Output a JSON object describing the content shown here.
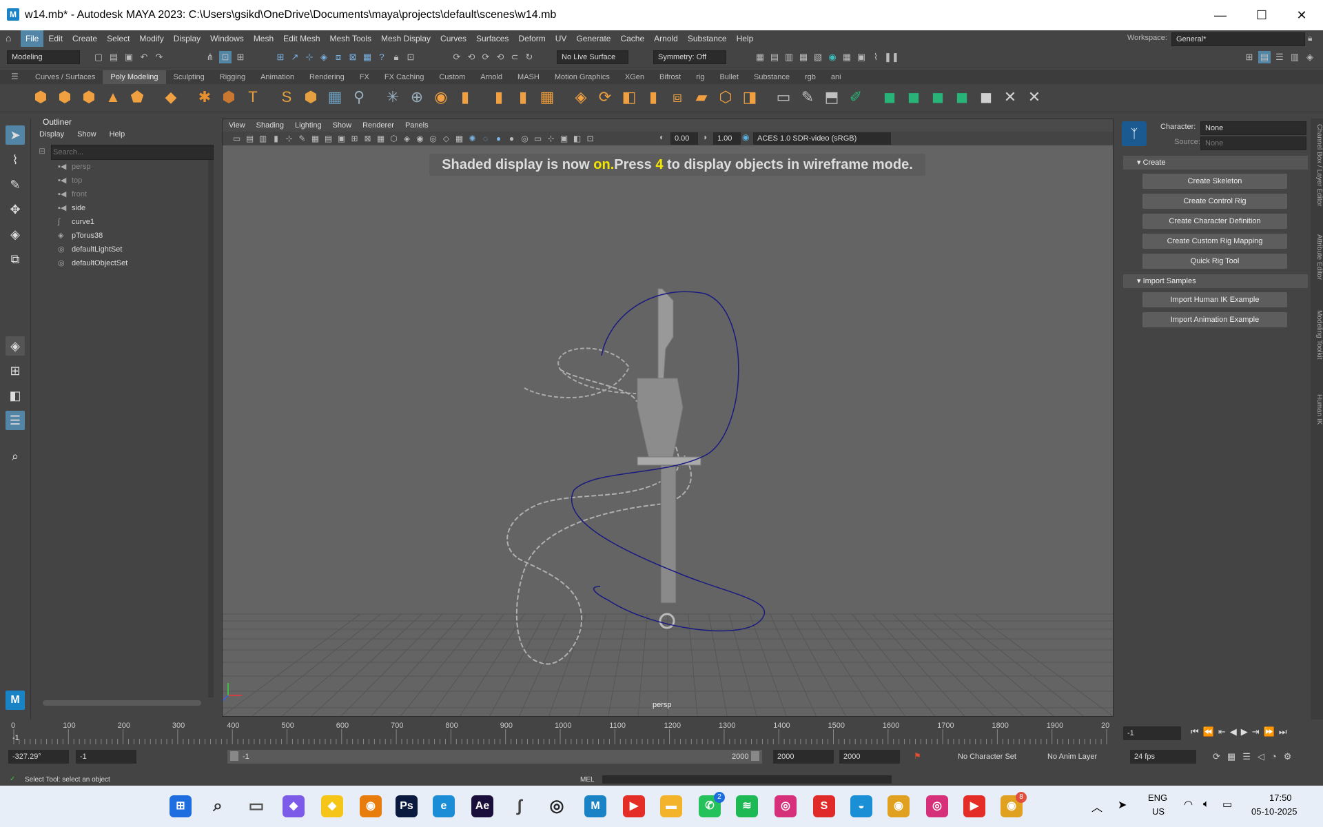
{
  "window": {
    "logo": "M",
    "title": "w14.mb* - Autodesk MAYA 2023: C:\\Users\\gsikd\\OneDrive\\Documents\\maya\\projects\\default\\scenes\\w14.mb",
    "minimize": "—",
    "maximize": "☐",
    "close": "✕"
  },
  "menubar": {
    "items": [
      "File",
      "Edit",
      "Create",
      "Select",
      "Modify",
      "Display",
      "Windows",
      "Mesh",
      "Edit Mesh",
      "Mesh Tools",
      "Mesh Display",
      "Curves",
      "Surfaces",
      "Deform",
      "UV",
      "Generate",
      "Cache",
      "Arnold",
      "Substance",
      "Help"
    ],
    "workspace_label": "Workspace:",
    "workspace_value": "General*"
  },
  "statusline": {
    "menuset": "Modeling",
    "live_surface": "No Live Surface",
    "symmetry": "Symmetry: Off"
  },
  "shelf": {
    "tabs": [
      "Curves / Surfaces",
      "Poly Modeling",
      "Sculpting",
      "Rigging",
      "Animation",
      "Rendering",
      "FX",
      "FX Caching",
      "Custom",
      "Arnold",
      "MASH",
      "Motion Graphics",
      "XGen",
      "Bifrost",
      "rig",
      "Bullet",
      "Substance",
      "rgb",
      "ani"
    ],
    "active_tab": "Poly Modeling",
    "colors": [
      "#f0a040",
      "#f0a040",
      "#f0a040",
      "#f0a040",
      "#f0a040",
      "#f0a040",
      "#e69030",
      "#c87830",
      "#e6a040",
      "#e6a040",
      "#e6a040",
      "#6fa0c0",
      "#9ab0c0",
      "#9ab0c0",
      "#9ab0c0",
      "#f0a040",
      "#f0a040",
      "#f0a040",
      "#f0a040",
      "#f0a040",
      "#f0a040",
      "#f0a040",
      "#f0a040",
      "#f0a040",
      "#f0a040",
      "#f0a040",
      "#f0a040",
      "#f0a040",
      "#c0c0c0",
      "#c0c0c0",
      "#c0c0c0",
      "#28b478",
      "#28b478",
      "#28b478",
      "#28b478",
      "#28b478",
      "#d0d0d0",
      "#d0d0d0",
      "#d0d0d0"
    ]
  },
  "outliner": {
    "title": "Outliner",
    "menu": [
      "Display",
      "Show",
      "Help"
    ],
    "search_placeholder": "Search...",
    "items": [
      {
        "label": "persp",
        "icon": "camera-icon",
        "dim": true
      },
      {
        "label": "top",
        "icon": "camera-icon",
        "dim": true
      },
      {
        "label": "front",
        "icon": "camera-icon",
        "dim": true
      },
      {
        "label": "side",
        "icon": "camera-icon",
        "dim": false
      },
      {
        "label": "curve1",
        "icon": "curve-icon",
        "dim": false
      },
      {
        "label": "pTorus38",
        "icon": "mesh-icon",
        "dim": false
      },
      {
        "label": "defaultLightSet",
        "icon": "set-icon",
        "dim": false
      },
      {
        "label": "defaultObjectSet",
        "icon": "set-icon",
        "dim": false
      }
    ]
  },
  "viewport": {
    "menu": [
      "View",
      "Shading",
      "Lighting",
      "Show",
      "Renderer",
      "Panels"
    ],
    "exposure": "0.00",
    "gamma": "1.00",
    "colorspace": "ACES 1.0 SDR-video (sRGB)",
    "message_part1": "Shaded display is now ",
    "message_on": "on.",
    "message_part2": "Press ",
    "message_key": "4",
    "message_part3": " to display objects in wireframe mode.",
    "camera_label": "persp"
  },
  "humanik": {
    "character_label": "Character:",
    "character_value": "None",
    "source_label": "Source:",
    "source_value": "None",
    "create_header": "Create",
    "create_buttons": [
      "Create Skeleton",
      "Create Control Rig",
      "Create Character Definition",
      "Create Custom Rig Mapping",
      "Quick Rig Tool"
    ],
    "samples_header": "Import Samples",
    "sample_buttons": [
      "Import Human IK Example",
      "Import Animation Example"
    ]
  },
  "sidetabs": [
    "Channel Box / Layer Editor",
    "Attribute Editor",
    "Modeling Toolkit",
    "Human IK"
  ],
  "timeline": {
    "ticks": [
      "0",
      "100",
      "200",
      "300",
      "400",
      "500",
      "600",
      "700",
      "800",
      "900",
      "1000",
      "1100",
      "1200",
      "1300",
      "1400",
      "1500",
      "1600",
      "1700",
      "1800",
      "1900",
      "20"
    ],
    "current_frame_marker": "-1",
    "current_frame_field": "-1"
  },
  "range": {
    "coord": "-327.29°",
    "start": "-1",
    "slider_start": "-1",
    "slider_end": "2000",
    "end1": "2000",
    "end2": "2000",
    "character_set": "No Character Set",
    "anim_layer": "No Anim Layer",
    "fps": "24 fps"
  },
  "helpline": {
    "text": "Select Tool: select an object",
    "mel": "MEL"
  },
  "taskbar": {
    "apps": [
      {
        "name": "start",
        "glyph": "⊞",
        "color": "#1e6ee0"
      },
      {
        "name": "search",
        "glyph": "⌕",
        "color": "#333"
      },
      {
        "name": "file-view",
        "glyph": "▭",
        "color": "#555"
      },
      {
        "name": "copilot",
        "glyph": "◆",
        "color": "#7b5be8"
      },
      {
        "name": "sticky",
        "glyph": "◆",
        "color": "#f5c518"
      },
      {
        "name": "blender",
        "glyph": "◉",
        "color": "#e87d0d"
      },
      {
        "name": "photoshop",
        "glyph": "Ps",
        "color": "#0a1a3f"
      },
      {
        "name": "edge",
        "glyph": "e",
        "color": "#1b8dd6"
      },
      {
        "name": "after-effects",
        "glyph": "Ae",
        "color": "#1a0f3a"
      },
      {
        "name": "ink",
        "glyph": "∫",
        "color": "#444"
      },
      {
        "name": "obs",
        "glyph": "◎",
        "color": "#222"
      },
      {
        "name": "maya",
        "glyph": "M",
        "color": "#1a83c6"
      },
      {
        "name": "youtube",
        "glyph": "▶",
        "color": "#e52d27"
      },
      {
        "name": "explorer",
        "glyph": "▬",
        "color": "#f3b42c"
      },
      {
        "name": "whatsapp",
        "glyph": "✆",
        "color": "#25c15a"
      },
      {
        "name": "spotify",
        "glyph": "≋",
        "color": "#1db954"
      },
      {
        "name": "instagram",
        "glyph": "◎",
        "color": "#d6307b"
      },
      {
        "name": "s-app",
        "glyph": "S",
        "color": "#e02a2a"
      },
      {
        "name": "sbi",
        "glyph": "◒",
        "color": "#1a8fd6"
      },
      {
        "name": "chrome",
        "glyph": "◉",
        "color": "#e0a020"
      },
      {
        "name": "instagram2",
        "glyph": "◎",
        "color": "#d6307b"
      },
      {
        "name": "youtube2",
        "glyph": "▶",
        "color": "#e52d27"
      },
      {
        "name": "chrome2",
        "glyph": "◉",
        "color": "#e0a020"
      }
    ],
    "whatsapp_badge": "2",
    "chrome_badge": "8",
    "lang1": "ENG",
    "lang2": "US",
    "time": "17:50",
    "date": "05-10-2025"
  }
}
